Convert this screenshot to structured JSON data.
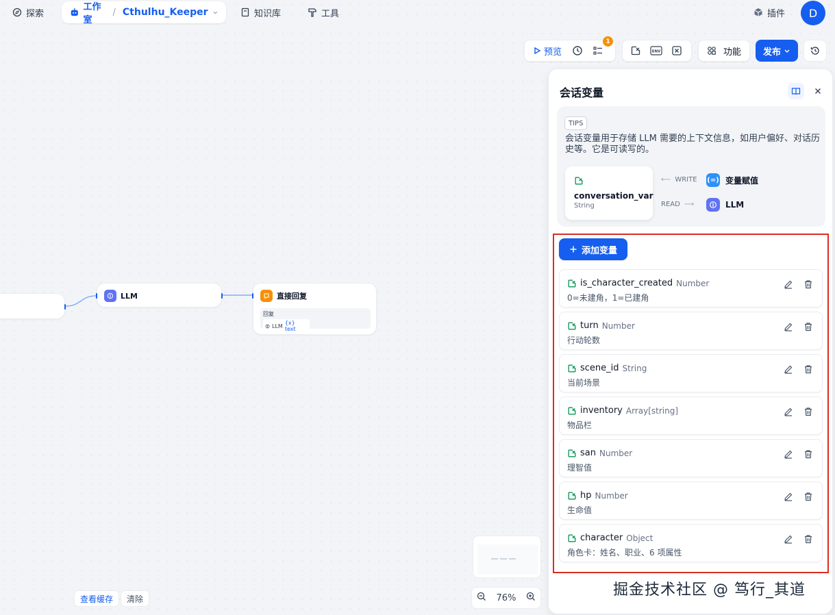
{
  "nav": {
    "explore": "探索",
    "studio": "工作室",
    "app_name": "Cthulhu_Keeper",
    "knowledge": "知识库",
    "tools": "工具",
    "plugins": "插件",
    "avatar": "D"
  },
  "toolbar": {
    "preview": "预览",
    "checklist_badge": "1",
    "features": "功能",
    "publish": "发布"
  },
  "nodes": {
    "llm": {
      "title": "LLM"
    },
    "reply": {
      "title": "直接回复",
      "field_label": "回复",
      "ref_node": "LLM",
      "ref_var": "{x} text"
    }
  },
  "panel": {
    "title": "会话变量",
    "tips_tag": "TIPS",
    "tips_text": "会话变量用于存储 LLM 需要的上下文信息，如用户偏好、对话历史等。它是可读写的。",
    "example_var_name": "conversation_var",
    "example_var_type": "String",
    "write_label": "WRITE",
    "write_target": "变量赋值",
    "read_label": "READ",
    "read_target": "LLM",
    "add_button": "添加变量",
    "variables": [
      {
        "name": "is_character_created",
        "type": "Number",
        "desc": "0=未建角，1=已建角"
      },
      {
        "name": "turn",
        "type": "Number",
        "desc": "行动轮数"
      },
      {
        "name": "scene_id",
        "type": "String",
        "desc": "当前场景"
      },
      {
        "name": "inventory",
        "type": "Array[string]",
        "desc": "物品栏"
      },
      {
        "name": "san",
        "type": "Number",
        "desc": "理智值"
      },
      {
        "name": "hp",
        "type": "Number",
        "desc": "生命值"
      },
      {
        "name": "character",
        "type": "Object",
        "desc": "角色卡：姓名、职业、6 项属性"
      }
    ]
  },
  "bottom": {
    "view_cache": "查看缓存",
    "clear": "清除",
    "zoom_level": "76%"
  },
  "watermark": "掘金技术社区 @ 笃行_其道",
  "colors": {
    "accent": "#155eef",
    "highlight_border": "#d92d20",
    "var_icon": "#079455"
  }
}
